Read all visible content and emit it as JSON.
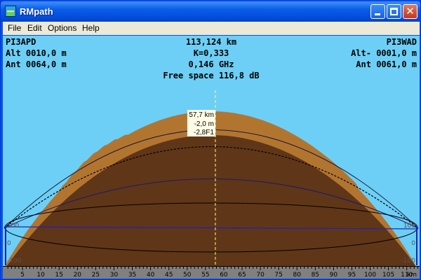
{
  "window": {
    "title": "RMpath"
  },
  "menu": {
    "file": "File",
    "edit": "Edit",
    "options": "Options",
    "help": "Help"
  },
  "left_station": {
    "name": "PI3APD",
    "alt": "Alt 0010,0 m",
    "ant": "Ant 0064,0 m"
  },
  "right_station": {
    "name": "PI3WAD",
    "alt": "Alt- 0001,0 m",
    "ant": "Ant 0061,0 m"
  },
  "path": {
    "distance": "113,124 km",
    "k_factor": "K=0,333",
    "frequency": "0,146 GHz",
    "free_space": "Free space 116,8 dB"
  },
  "cursor_readout": {
    "distance": "57,7 km",
    "height": "-2,0 m",
    "clearance": "-2,8F1"
  },
  "scale_labels": {
    "left_top": "100",
    "left_mid": "0",
    "left_bottom": "-100",
    "right_top": "100",
    "right_mid": "0",
    "right_bottom": "-100"
  },
  "axis": {
    "unit": "km",
    "max_km": 113.124,
    "ticks": [
      "5",
      "10",
      "15",
      "20",
      "25",
      "30",
      "35",
      "40",
      "45",
      "50",
      "55",
      "60",
      "65",
      "70",
      "75",
      "80",
      "85",
      "90",
      "95",
      "100",
      "105",
      "110"
    ]
  },
  "colors": {
    "sky": "#6dcff6",
    "terrain": "#b27530",
    "earth": "#603618",
    "axis_bg": "#808080",
    "fresnel": "#1a1a6e",
    "los": "#2020c0",
    "cursor": "#ffff80"
  }
}
